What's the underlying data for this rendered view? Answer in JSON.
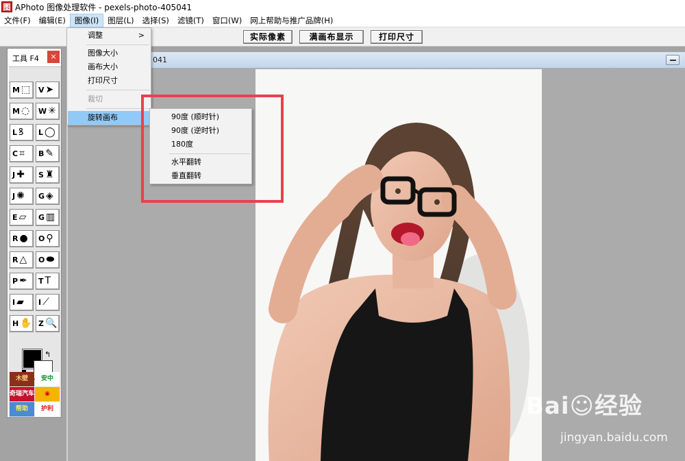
{
  "window": {
    "icon_glyph": "图",
    "title": "APhoto 图像处理软件 - pexels-photo-405041"
  },
  "menubar": {
    "items": [
      "文件(F)",
      "编辑(E)",
      "图像(I)",
      "图层(L)",
      "选择(S)",
      "滤镜(T)",
      "窗口(W)",
      "网上帮助与推广品牌(H)"
    ],
    "active_index": 2
  },
  "toolbar": {
    "actual_pixels": "实际像素",
    "fit_canvas": "满画布显示",
    "print_size": "打印尺寸"
  },
  "document": {
    "title_fragment": "041"
  },
  "image_menu": {
    "adjust": "调整",
    "image_size": "图像大小",
    "canvas_size": "画布大小",
    "print_size": "打印尺寸",
    "crop": "裁切",
    "rotate_canvas": "旋转画布",
    "submenu_arrow": ">"
  },
  "rotate_submenu": {
    "cw90": "90度 (顺时针)",
    "ccw90": "90度 (逆时针)",
    "r180": "180度",
    "flip_h": "水平翻转",
    "flip_v": "垂直翻转"
  },
  "tools_panel": {
    "title": "工具 F4",
    "close": "×",
    "tools": [
      {
        "key": "M",
        "icon": "rect-marquee-icon",
        "glyph": "⬚"
      },
      {
        "key": "V",
        "icon": "move-icon",
        "glyph": "➤"
      },
      {
        "key": "M",
        "icon": "ellipse-marquee-icon",
        "glyph": "◌"
      },
      {
        "key": "W",
        "icon": "magic-wand-icon",
        "glyph": "✳"
      },
      {
        "key": "L",
        "icon": "lasso-icon",
        "glyph": "ꝸ"
      },
      {
        "key": "L",
        "icon": "polygon-lasso-icon",
        "glyph": "◯"
      },
      {
        "key": "C",
        "icon": "crop-icon",
        "glyph": "⌗"
      },
      {
        "key": "B",
        "icon": "brush-icon",
        "glyph": "✎"
      },
      {
        "key": "J",
        "icon": "bandage-icon",
        "glyph": "✚"
      },
      {
        "key": "S",
        "icon": "stamp-icon",
        "glyph": "♜"
      },
      {
        "key": "J",
        "icon": "patch-icon",
        "glyph": "✺"
      },
      {
        "key": "G",
        "icon": "paint-bucket-icon",
        "glyph": "◈"
      },
      {
        "key": "E",
        "icon": "eraser-icon",
        "glyph": "▱"
      },
      {
        "key": "G",
        "icon": "gradient-icon",
        "glyph": "▥"
      },
      {
        "key": "R",
        "icon": "blur-drop-icon",
        "glyph": "●"
      },
      {
        "key": "O",
        "icon": "dodge-icon",
        "glyph": "⚲"
      },
      {
        "key": "R",
        "icon": "sharpen-icon",
        "glyph": "△"
      },
      {
        "key": "O",
        "icon": "sponge-icon",
        "glyph": "⬬"
      },
      {
        "key": "P",
        "icon": "pen-icon",
        "glyph": "✒"
      },
      {
        "key": "T",
        "icon": "text-icon",
        "glyph": "T"
      },
      {
        "key": "I",
        "icon": "ruler-icon",
        "glyph": "▰"
      },
      {
        "key": "I",
        "icon": "eyedropper-icon",
        "glyph": "⟋"
      },
      {
        "key": "H",
        "icon": "hand-icon",
        "glyph": "✋"
      },
      {
        "key": "Z",
        "icon": "zoom-icon",
        "glyph": "🔍"
      }
    ],
    "swap_glyph": "↰",
    "ads": [
      {
        "text": "木壁",
        "color": "#8b2f1a",
        "fg": "#f3d17a"
      },
      {
        "text": "安中",
        "color": "#ffffff",
        "fg": "#1b8a2e"
      },
      {
        "text": "奇瑞汽车",
        "color": "#c8102e",
        "fg": "#ffffff"
      },
      {
        "text": "◉",
        "color": "#f6b400",
        "fg": "#d4001a"
      },
      {
        "text": "帮助",
        "color": "#4a8ad8",
        "fg": "#ffe95c"
      },
      {
        "text": "护利",
        "color": "#ffffff",
        "fg": "#e4161b"
      }
    ]
  },
  "watermark": {
    "logo": "Bai☺经验",
    "url": "jingyan.baidu.com"
  },
  "colors": {
    "menu_highlight": "#91c9f7",
    "annotation_red": "#ec3f4e",
    "workspace_gray": "#a3a3a3"
  }
}
